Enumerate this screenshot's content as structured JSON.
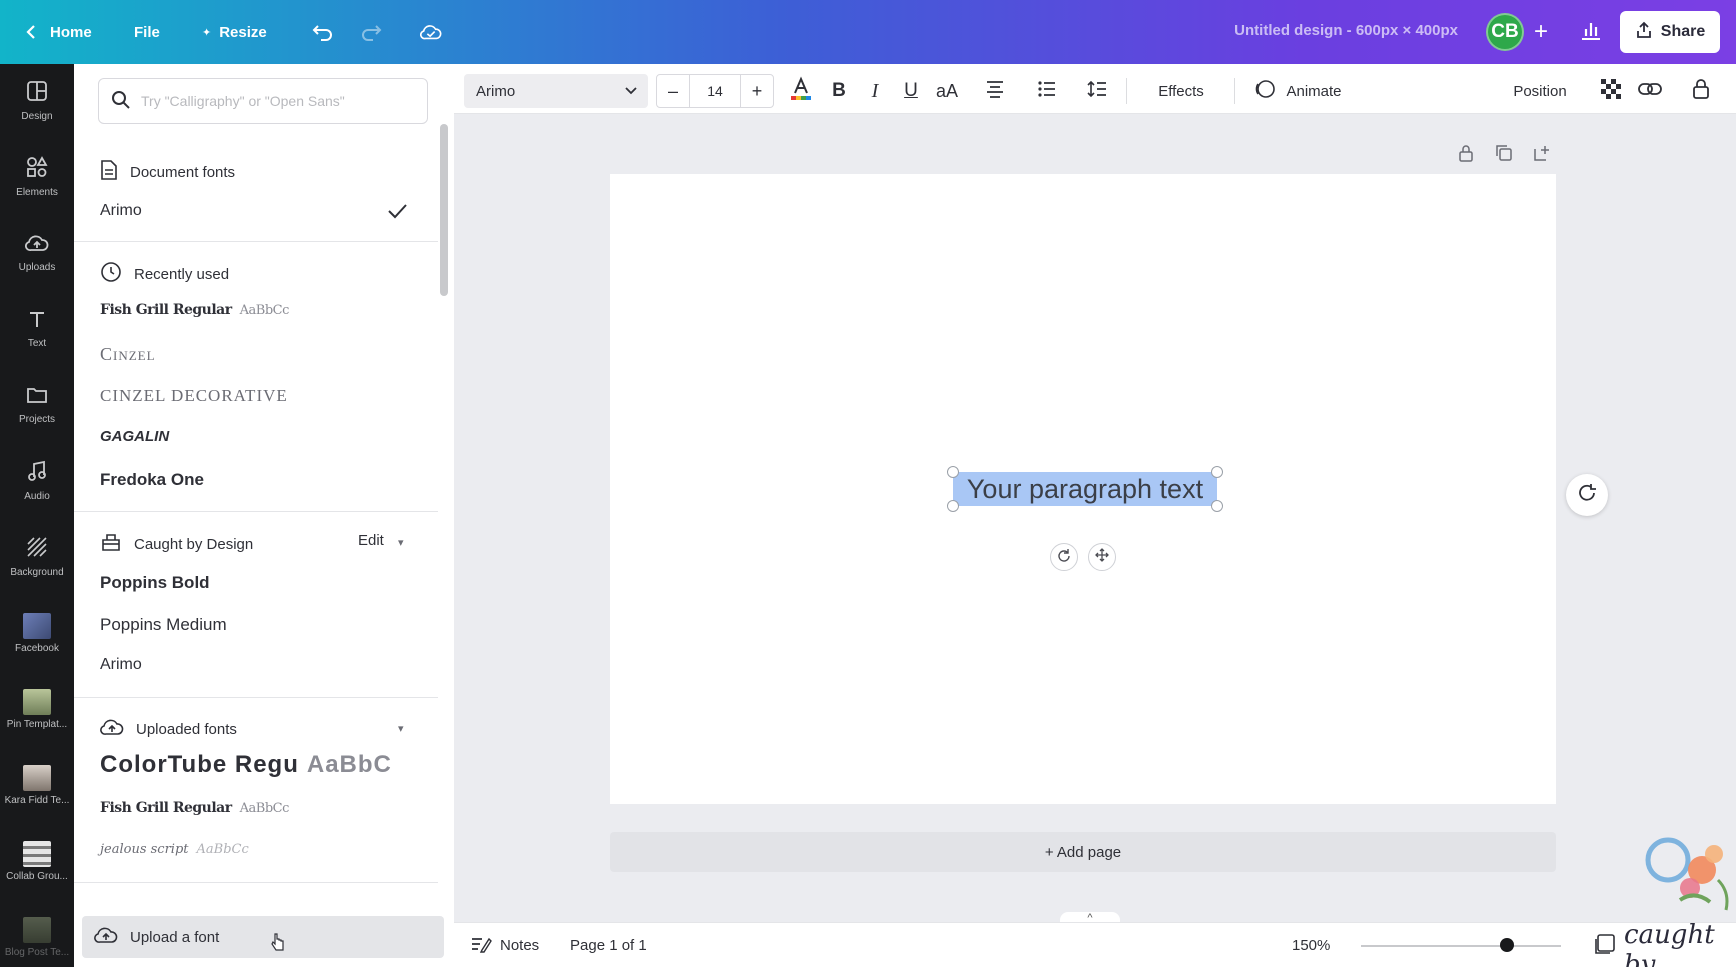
{
  "topbar": {
    "home": "Home",
    "file": "File",
    "resize": "Resize",
    "title": "Untitled design - 600px × 400px",
    "avatar": "CB",
    "share": "Share"
  },
  "rail": [
    {
      "label": "Design"
    },
    {
      "label": "Elements"
    },
    {
      "label": "Uploads"
    },
    {
      "label": "Text"
    },
    {
      "label": "Projects"
    },
    {
      "label": "Audio"
    },
    {
      "label": "Background"
    },
    {
      "label": "Facebook"
    },
    {
      "label": "Pin Templat..."
    },
    {
      "label": "Kara Fidd Te..."
    },
    {
      "label": "Collab Grou..."
    },
    {
      "label": "Blog Post Te..."
    }
  ],
  "panel": {
    "search_placeholder": "Try \"Calligraphy\" or \"Open Sans\"",
    "document_fonts": {
      "title": "Document fonts",
      "items": [
        "Arimo"
      ]
    },
    "recently_used": {
      "title": "Recently used",
      "items": [
        "Fish Grill Regular",
        "Cinzel",
        "Cinzel Decorative",
        "GAGALIN",
        "Fredoka One"
      ],
      "samples": [
        "AaBbCc"
      ]
    },
    "brand_kit": {
      "title": "Caught by Design",
      "edit": "Edit",
      "items": [
        "Poppins Bold",
        "Poppins Medium",
        "Arimo"
      ]
    },
    "uploaded": {
      "title": "Uploaded fonts",
      "items": [
        "ColorTube Regu",
        "Fish Grill Regular",
        "jealous script"
      ],
      "samples": [
        "AaBbC",
        "AaBbCc",
        "AaBbCc"
      ]
    },
    "upload_button": "Upload a font"
  },
  "toolbar": {
    "font": "Arimo",
    "size": "14",
    "effects": "Effects",
    "animate": "Animate",
    "position": "Position"
  },
  "canvas": {
    "text": "Your paragraph text",
    "add_page": "+ Add page"
  },
  "bottom": {
    "notes": "Notes",
    "page": "Page 1 of 1",
    "zoom": "150%",
    "zoom_level": 0.7
  },
  "colors": {
    "accent": "#7b3fe4",
    "selection": "#a9c7f5",
    "avatar": "#2ea84a",
    "rail": "#18191b"
  }
}
